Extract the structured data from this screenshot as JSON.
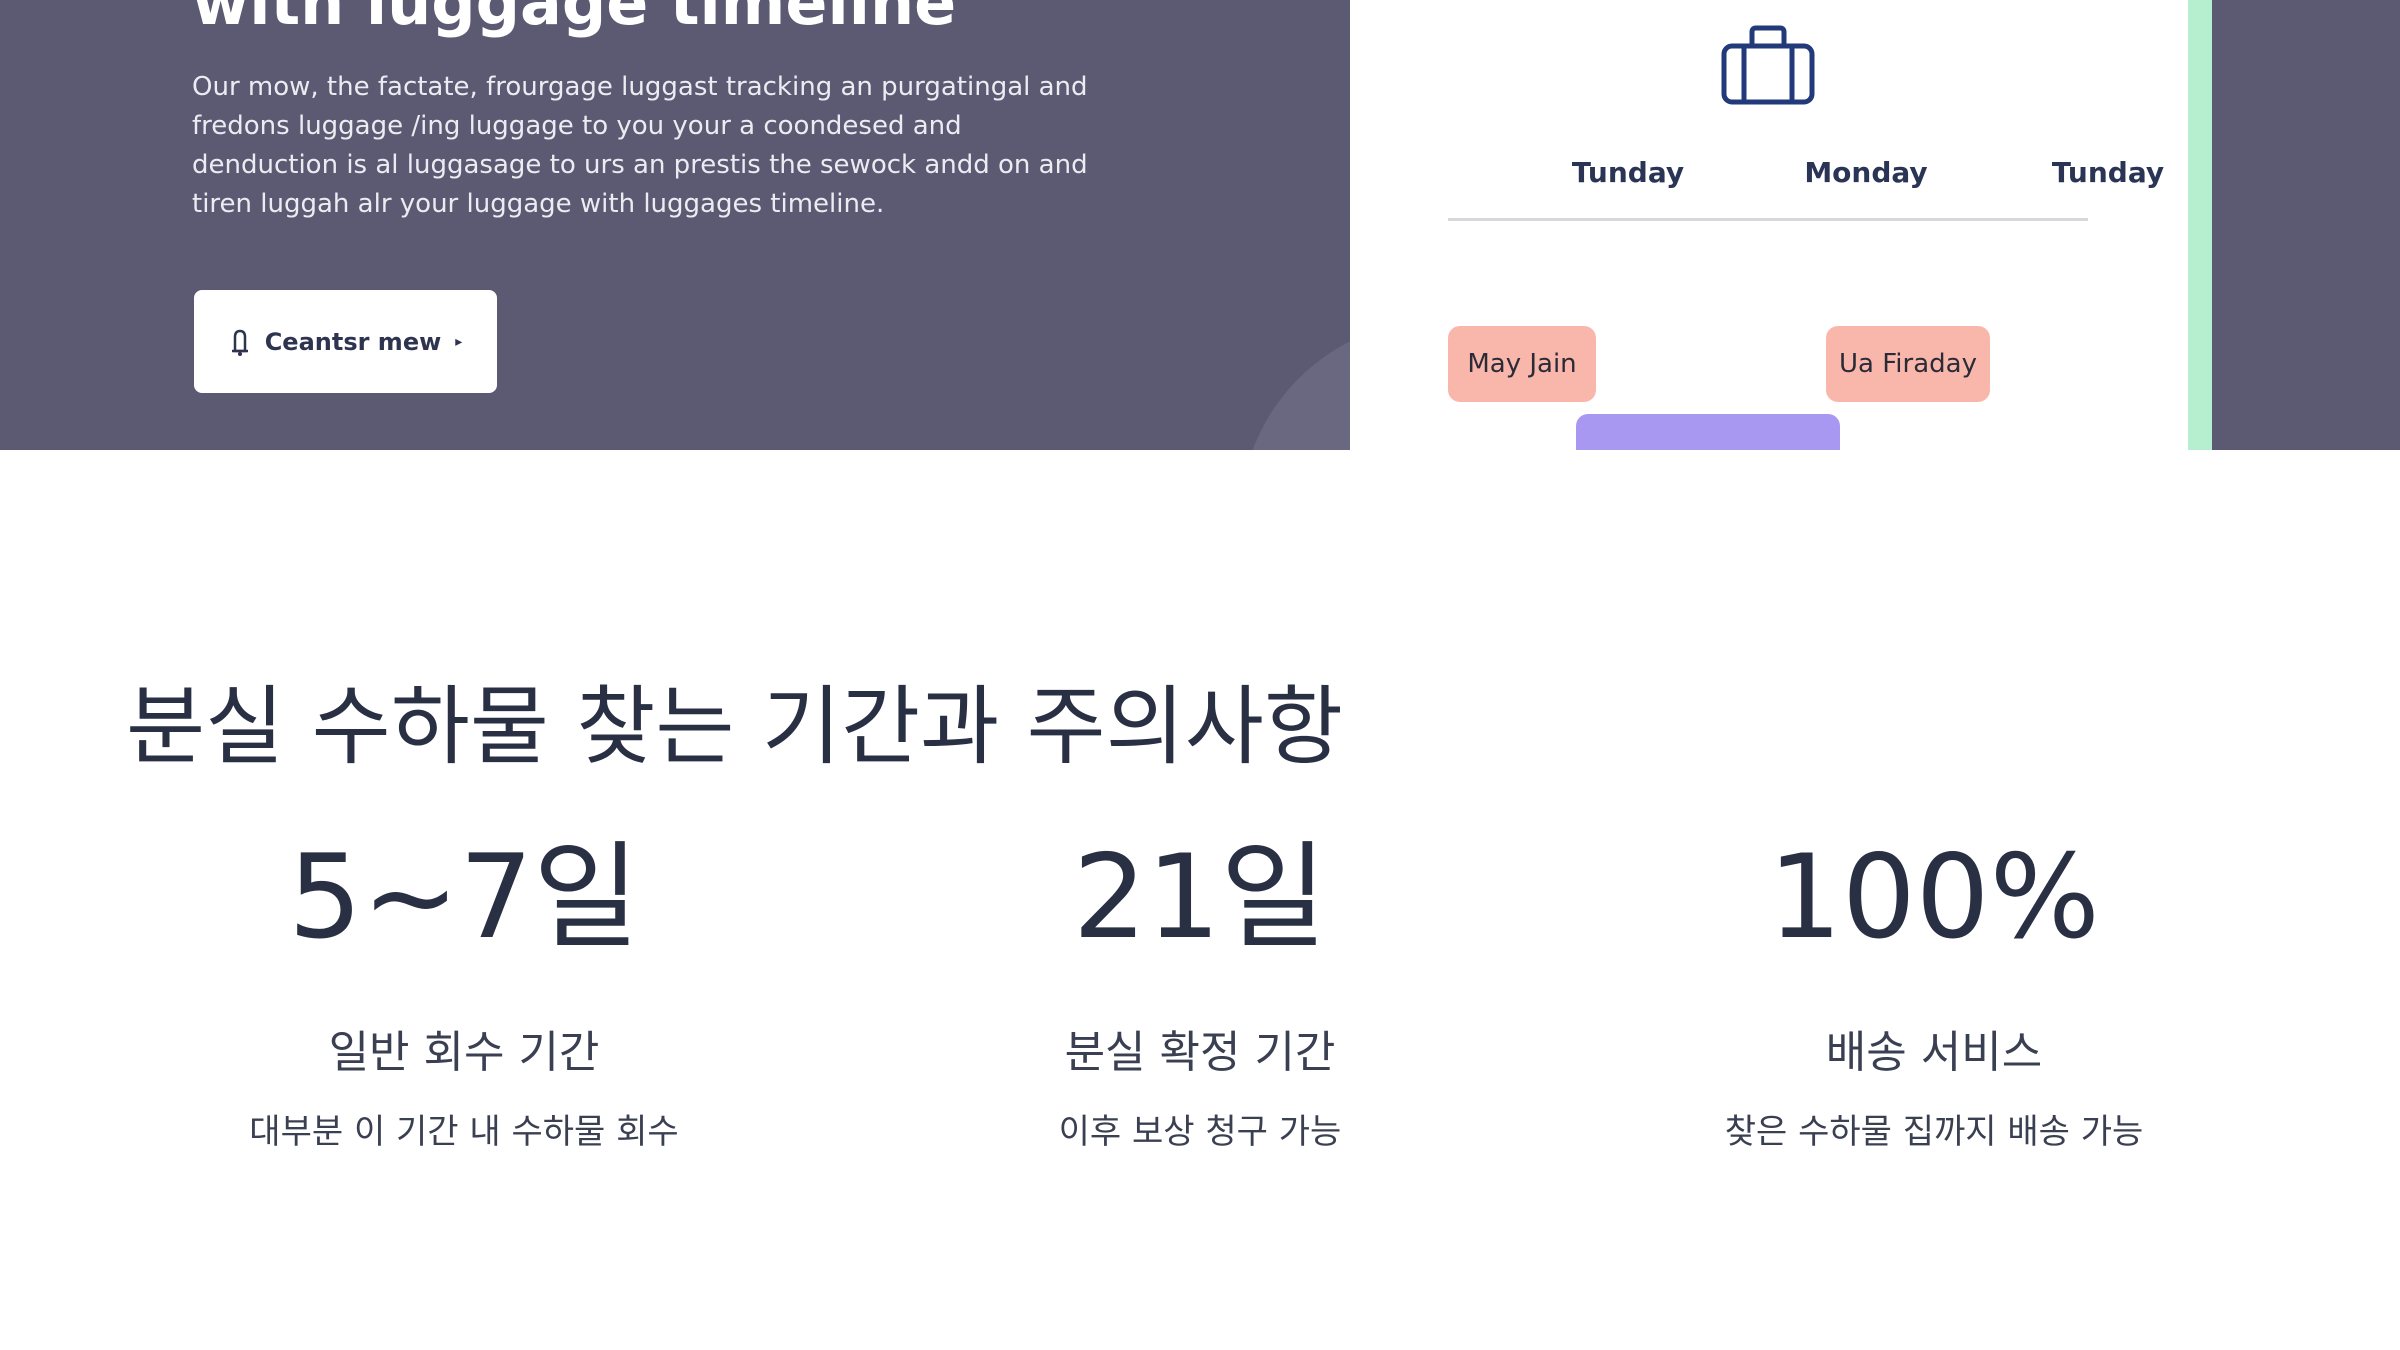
{
  "hero": {
    "title": "with luggage timeline",
    "description": "Our mow, the factate, frourgage luggast tracking an purgatingal and fredons luggage /ing luggage to you your a coondesed and denduction is al luggasage to urs an prestis the sewock andd on and tiren luggah alr your luggage with luggages timeline.",
    "cta_label": "Ceantsr mew",
    "cta_icon": "bell-icon"
  },
  "timeline_card": {
    "icon": "suitcase-icon",
    "days": [
      "Tunday",
      "Monday",
      "Tunday"
    ],
    "events": [
      "May Jain",
      "Ua Firaday",
      ""
    ],
    "colors": {
      "event_pink": "#f9b7ab",
      "event_purple": "#a998f2",
      "stripe": "#b5efcf"
    }
  },
  "section": {
    "title": "분실 수하물 찾는 기간과 주의사항",
    "stats": [
      {
        "value": "5~7일",
        "label": "일반 회수 기간",
        "desc": "대부분 이 기간 내 수하물 회수"
      },
      {
        "value": "21일",
        "label": "분실 확정 기간",
        "desc": "이후 보상 청구 가능"
      },
      {
        "value": "100%",
        "label": "배송 서비스",
        "desc": "찾은 수하물 집까지 배송 가능"
      }
    ]
  },
  "colors": {
    "hero_bg": "#5c5a72",
    "text_dark": "#2a3044"
  }
}
